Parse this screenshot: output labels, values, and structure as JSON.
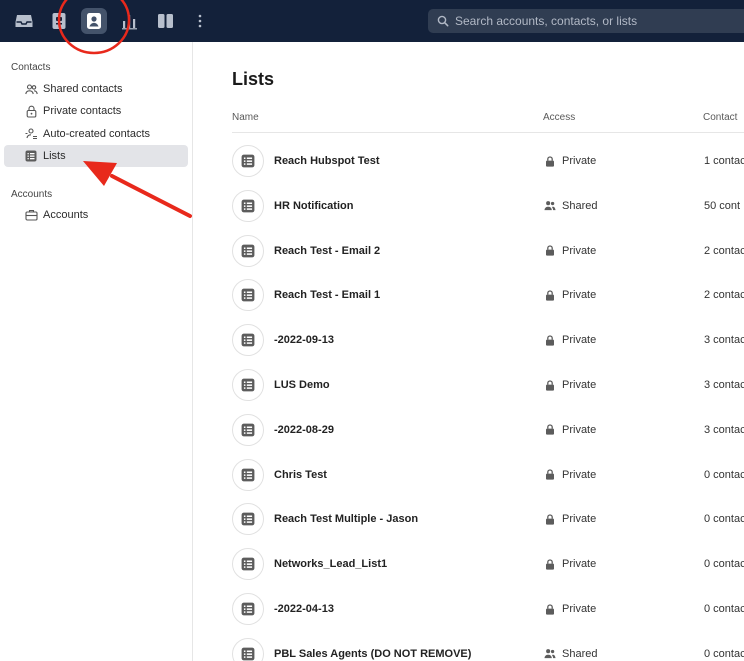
{
  "topbar": {
    "icons": [
      "inbox-icon",
      "contacts-book-icon",
      "contact-card-icon",
      "bar-chart-icon",
      "columns-icon",
      "more-vertical-icon"
    ],
    "active_icon": "contact-card-icon",
    "search": {
      "placeholder": "Search accounts, contacts, or lists",
      "icon": "search-icon"
    }
  },
  "sidebar": {
    "contacts_section": "Contacts",
    "contacts_items": [
      {
        "label": "Shared contacts",
        "icon": "people-icon"
      },
      {
        "label": "Private contacts",
        "icon": "lock-icon"
      },
      {
        "label": "Auto-created contacts",
        "icon": "auto-people-icon"
      },
      {
        "label": "Lists",
        "icon": "list-icon",
        "selected": true
      }
    ],
    "accounts_section": "Accounts",
    "accounts_items": [
      {
        "label": "Accounts",
        "icon": "briefcase-icon"
      }
    ]
  },
  "main": {
    "title": "Lists",
    "columns": {
      "name": "Name",
      "access": "Access",
      "contacts": "Contact"
    },
    "rows": [
      {
        "name": "Reach Hubspot Test",
        "access": "Private",
        "count": "1 contac"
      },
      {
        "name": "HR Notification",
        "access": "Shared",
        "count": "50 cont"
      },
      {
        "name": "Reach Test - Email 2",
        "access": "Private",
        "count": "2 contac"
      },
      {
        "name": "Reach Test - Email 1",
        "access": "Private",
        "count": "2 contac"
      },
      {
        "name": "-2022-09-13",
        "access": "Private",
        "count": "3 contac"
      },
      {
        "name": "LUS Demo",
        "access": "Private",
        "count": "3 contac"
      },
      {
        "name": "-2022-08-29",
        "access": "Private",
        "count": "3 contac"
      },
      {
        "name": "Chris Test",
        "access": "Private",
        "count": "0 contac"
      },
      {
        "name": "Reach Test Multiple - Jason",
        "access": "Private",
        "count": "0 contac"
      },
      {
        "name": "Networks_Lead_List1",
        "access": "Private",
        "count": "0 contac"
      },
      {
        "name": "-2022-04-13",
        "access": "Private",
        "count": "0 contac"
      },
      {
        "name": "PBL Sales Agents (DO NOT REMOVE)",
        "access": "Shared",
        "count": "0 contac"
      }
    ]
  },
  "colors": {
    "topbar_bg": "#13213a",
    "annotation_red": "#e8291c",
    "selected_bg": "#e3e4e8"
  }
}
